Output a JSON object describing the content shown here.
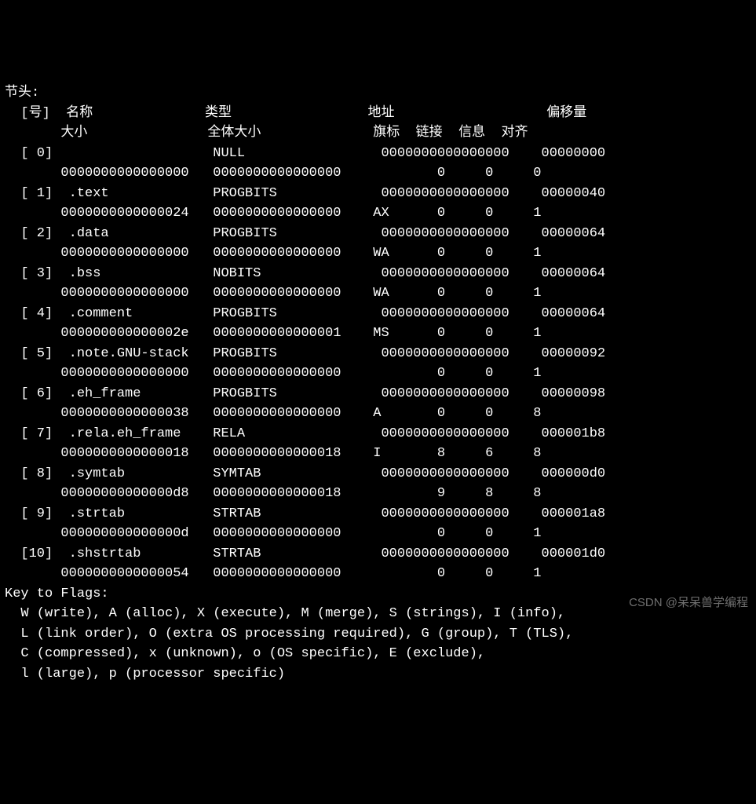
{
  "title": "节头:",
  "hdr1": {
    "idx": "  [号]",
    "name": "名称",
    "type": "类型",
    "addr": "地址",
    "offset": "偏移量"
  },
  "hdr2": {
    "size": "大小",
    "entsize": "全体大小",
    "flags": "旗标",
    "link": "链接",
    "info": "信息",
    "align": "对齐"
  },
  "sections": [
    {
      "idx": "[ 0]",
      "name": "",
      "type": "NULL",
      "addr": "0000000000000000",
      "offset": "00000000",
      "size": "0000000000000000",
      "entsize": "0000000000000000",
      "flags": "",
      "link": "0",
      "info": "0",
      "align": "0"
    },
    {
      "idx": "[ 1]",
      "name": ".text",
      "type": "PROGBITS",
      "addr": "0000000000000000",
      "offset": "00000040",
      "size": "0000000000000024",
      "entsize": "0000000000000000",
      "flags": "AX",
      "link": "0",
      "info": "0",
      "align": "1"
    },
    {
      "idx": "[ 2]",
      "name": ".data",
      "type": "PROGBITS",
      "addr": "0000000000000000",
      "offset": "00000064",
      "size": "0000000000000000",
      "entsize": "0000000000000000",
      "flags": "WA",
      "link": "0",
      "info": "0",
      "align": "1"
    },
    {
      "idx": "[ 3]",
      "name": ".bss",
      "type": "NOBITS",
      "addr": "0000000000000000",
      "offset": "00000064",
      "size": "0000000000000000",
      "entsize": "0000000000000000",
      "flags": "WA",
      "link": "0",
      "info": "0",
      "align": "1"
    },
    {
      "idx": "[ 4]",
      "name": ".comment",
      "type": "PROGBITS",
      "addr": "0000000000000000",
      "offset": "00000064",
      "size": "000000000000002e",
      "entsize": "0000000000000001",
      "flags": "MS",
      "link": "0",
      "info": "0",
      "align": "1"
    },
    {
      "idx": "[ 5]",
      "name": ".note.GNU-stack",
      "type": "PROGBITS",
      "addr": "0000000000000000",
      "offset": "00000092",
      "size": "0000000000000000",
      "entsize": "0000000000000000",
      "flags": "",
      "link": "0",
      "info": "0",
      "align": "1"
    },
    {
      "idx": "[ 6]",
      "name": ".eh_frame",
      "type": "PROGBITS",
      "addr": "0000000000000000",
      "offset": "00000098",
      "size": "0000000000000038",
      "entsize": "0000000000000000",
      "flags": "A",
      "link": "0",
      "info": "0",
      "align": "8"
    },
    {
      "idx": "[ 7]",
      "name": ".rela.eh_frame",
      "type": "RELA",
      "addr": "0000000000000000",
      "offset": "000001b8",
      "size": "0000000000000018",
      "entsize": "0000000000000018",
      "flags": "I",
      "link": "8",
      "info": "6",
      "align": "8"
    },
    {
      "idx": "[ 8]",
      "name": ".symtab",
      "type": "SYMTAB",
      "addr": "0000000000000000",
      "offset": "000000d0",
      "size": "00000000000000d8",
      "entsize": "0000000000000018",
      "flags": "",
      "link": "9",
      "info": "8",
      "align": "8"
    },
    {
      "idx": "[ 9]",
      "name": ".strtab",
      "type": "STRTAB",
      "addr": "0000000000000000",
      "offset": "000001a8",
      "size": "000000000000000d",
      "entsize": "0000000000000000",
      "flags": "",
      "link": "0",
      "info": "0",
      "align": "1"
    },
    {
      "idx": "[10]",
      "name": ".shstrtab",
      "type": "STRTAB",
      "addr": "0000000000000000",
      "offset": "000001d0",
      "size": "0000000000000054",
      "entsize": "0000000000000000",
      "flags": "",
      "link": "0",
      "info": "0",
      "align": "1"
    }
  ],
  "key_title": "Key to Flags:",
  "key_lines": [
    "  W (write), A (alloc), X (execute), M (merge), S (strings), I (info),",
    "  L (link order), O (extra OS processing required), G (group), T (TLS),",
    "  C (compressed), x (unknown), o (OS specific), E (exclude),",
    "  l (large), p (processor specific)"
  ],
  "watermark": "CSDN @呆呆兽学编程"
}
